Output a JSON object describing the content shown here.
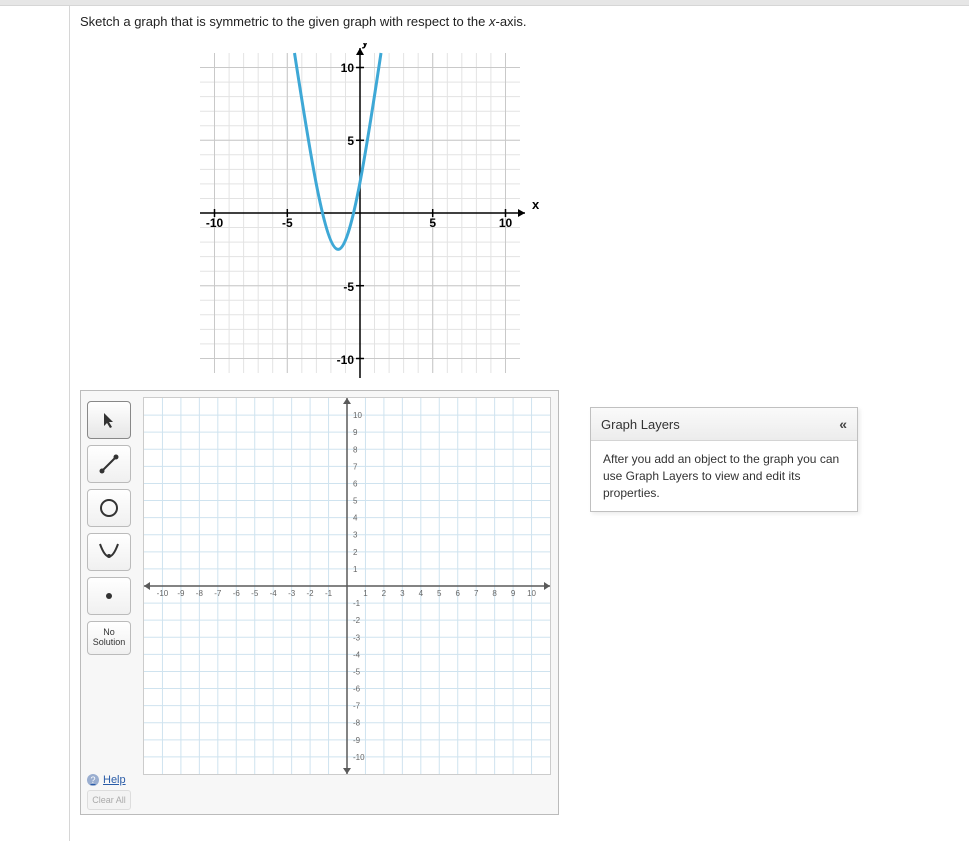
{
  "question": {
    "prefix": "Sketch a graph that is symmetric to the given graph with respect to the ",
    "italic": "x",
    "suffix": "-axis."
  },
  "static_chart": {
    "axis_labels": {
      "x": "x",
      "y": "y"
    },
    "x_ticks": [
      "-10",
      "-5",
      "5",
      "10"
    ],
    "y_ticks": [
      "10",
      "5",
      "-5",
      "-10"
    ]
  },
  "toolbar": {
    "pointer": "Pointer",
    "line": "Line",
    "circle": "Circle",
    "parabola": "Parabola",
    "point": "Point",
    "no_solution_l1": "No",
    "no_solution_l2": "Solution"
  },
  "interactive_chart": {
    "x_ticks": [
      "-10",
      "-9",
      "-8",
      "-7",
      "-6",
      "-5",
      "-4",
      "-3",
      "-2",
      "-1",
      "1",
      "2",
      "3",
      "4",
      "5",
      "6",
      "7",
      "8",
      "9",
      "10"
    ],
    "y_ticks_top": [
      "10",
      "9",
      "8",
      "7",
      "6",
      "5",
      "4",
      "3",
      "2",
      "1"
    ],
    "y_ticks_bottom": [
      "-1",
      "-2",
      "-3",
      "-4",
      "-5",
      "-6",
      "-7",
      "-8",
      "-9",
      "-10"
    ]
  },
  "bottom": {
    "help": "Help",
    "clear": "Clear All"
  },
  "layers": {
    "title": "Graph Layers",
    "body": "After you add an object to the graph you can use Graph Layers to view and edit its properties."
  },
  "chart_data": {
    "type": "line",
    "title": "",
    "xlabel": "x",
    "ylabel": "y",
    "xlim": [
      -11,
      11
    ],
    "ylim": [
      -11,
      11
    ],
    "grid": true,
    "description": "Upward-opening parabola with vertex approximately (-1.5, -2.5); passes through y-axis near y ≈ -0.5 and rises steeply through top of plot",
    "series": [
      {
        "name": "given graph",
        "x": [
          -4.5,
          -4.0,
          -3.5,
          -3.0,
          -2.5,
          -2.0,
          -1.5,
          -1.0,
          -0.5,
          0.0,
          0.5,
          1.0,
          1.2
        ],
        "y": [
          11.0,
          7.0,
          3.5,
          1.0,
          -0.7,
          -2.0,
          -2.5,
          -2.0,
          -0.7,
          1.0,
          3.5,
          7.0,
          11.0
        ]
      }
    ]
  }
}
